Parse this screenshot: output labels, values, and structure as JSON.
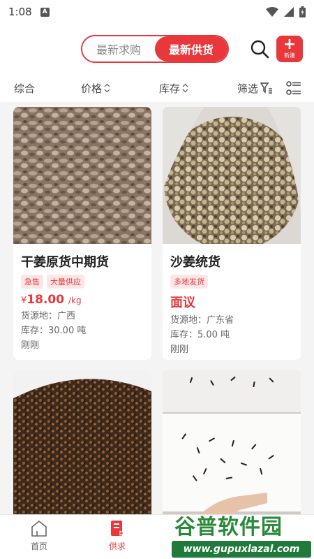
{
  "status_bar": {
    "time": "1:08",
    "badge": "A"
  },
  "header": {
    "tabs": [
      "最新求购",
      "最新供货"
    ],
    "active_tab": 1,
    "new_button_label": "新建",
    "accent_color": "#e8383b"
  },
  "filters": {
    "overall": "综合",
    "price": "价格",
    "stock": "库存",
    "screen": "筛选"
  },
  "products": [
    {
      "title": "干姜原货中期货",
      "tags": [
        "急售",
        "大量供应"
      ],
      "price_symbol": "¥",
      "price_value": "18.00",
      "price_unit": "/kg",
      "origin": "货源地：广西",
      "stock": "库存：30.00 吨",
      "time": "刚刚"
    },
    {
      "title": "沙姜统货",
      "tags": [
        "多地发货"
      ],
      "price_text": "面议",
      "origin": "货源地：广东省",
      "stock": "库存：5.00 吨",
      "time": "刚刚"
    },
    {
      "title": "",
      "image": "cloves-pile"
    },
    {
      "title": "",
      "image": "cloves-on-paper"
    }
  ],
  "bottom_nav": [
    {
      "label": "首页",
      "icon": "home-icon",
      "active": false
    },
    {
      "label": "供求",
      "icon": "supply-demand-icon",
      "active": true
    }
  ],
  "watermark": {
    "title": "谷普软件园",
    "url": "www.gupuxlazal.com"
  }
}
